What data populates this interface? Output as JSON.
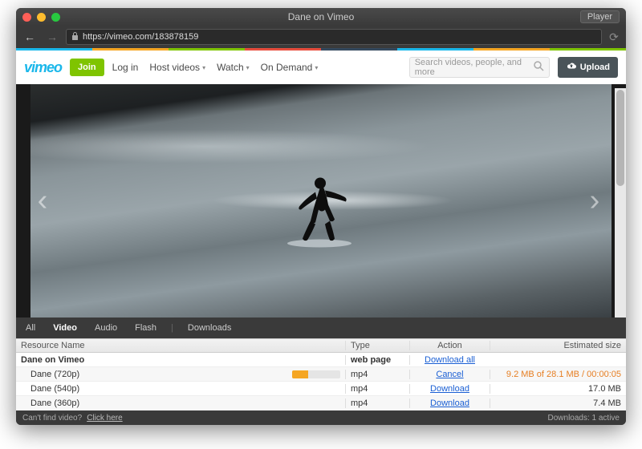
{
  "window": {
    "title": "Dane on Vimeo",
    "player_button": "Player"
  },
  "url": "https://vimeo.com/183878159",
  "rainbow": [
    "#1ab7ea",
    "#f5a623",
    "#7fc400",
    "#e74c3c",
    "#34495e",
    "#1ab7ea",
    "#f5a623",
    "#7fc400"
  ],
  "vimeo": {
    "logo": "vimeo",
    "join": "Join",
    "nav": [
      "Log in",
      "Host videos",
      "Watch",
      "On Demand"
    ],
    "nav_has_caret": [
      false,
      true,
      true,
      true
    ],
    "search_placeholder": "Search videos, people, and more",
    "upload": "Upload"
  },
  "tabs": {
    "items": [
      "All",
      "Video",
      "Audio",
      "Flash"
    ],
    "active": 1,
    "downloads": "Downloads"
  },
  "table": {
    "headers": {
      "name": "Resource Name",
      "type": "Type",
      "action": "Action",
      "size": "Estimated size"
    },
    "rows": [
      {
        "name": "Dane on Vimeo",
        "bold": true,
        "type": "web page",
        "type_bold": true,
        "action": "Download all",
        "size": "",
        "progress": null
      },
      {
        "name": "Dane (720p)",
        "bold": false,
        "type": "mp4",
        "type_bold": false,
        "action": "Cancel",
        "size": "9.2 MB of 28.1 MB / 00:00:05",
        "size_orange": true,
        "progress": 33
      },
      {
        "name": "Dane (540p)",
        "bold": false,
        "type": "mp4",
        "type_bold": false,
        "action": "Download",
        "size": "17.0 MB",
        "progress": null
      },
      {
        "name": "Dane (360p)",
        "bold": false,
        "type": "mp4",
        "type_bold": false,
        "action": "Download",
        "size": "7.4 MB",
        "progress": null
      }
    ]
  },
  "footer": {
    "left_q": "Can't find video?",
    "left_link": "Click here",
    "right": "Downloads: 1 active"
  }
}
